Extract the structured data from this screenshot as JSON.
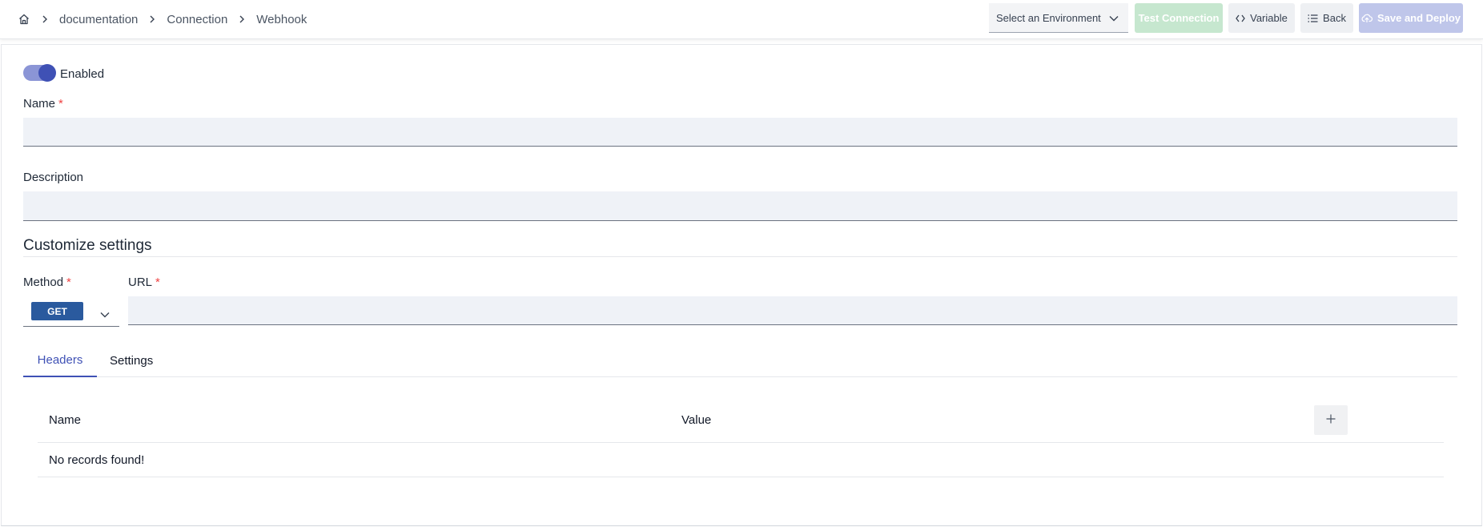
{
  "breadcrumb": {
    "home_icon": "home-icon",
    "items": [
      "documentation",
      "Connection"
    ],
    "current": "Webhook"
  },
  "toolbar": {
    "environment_placeholder": "Select an Environment",
    "test_connection_label": "Test Connection",
    "variable_label": "Variable",
    "back_label": "Back",
    "save_deploy_label": "Save and Deploy"
  },
  "form": {
    "enabled_label": "Enabled",
    "enabled": true,
    "name_label": "Name",
    "name_value": "",
    "description_label": "Description",
    "description_value": "",
    "required_mark": "*"
  },
  "customize": {
    "title": "Customize settings",
    "method_label": "Method",
    "method_value": "GET",
    "url_label": "URL",
    "url_value": ""
  },
  "tabs": {
    "headers": "Headers",
    "settings": "Settings",
    "active": "Headers"
  },
  "table": {
    "columns": [
      "Name",
      "Value"
    ],
    "empty_text": "No records found!"
  },
  "colors": {
    "accent": "#3f51b5",
    "method_badge": "#2a5a9e",
    "test_connection_bg": "#c6e7cf",
    "save_deploy_bg": "#bfc6ea",
    "required": "#ef4444"
  }
}
